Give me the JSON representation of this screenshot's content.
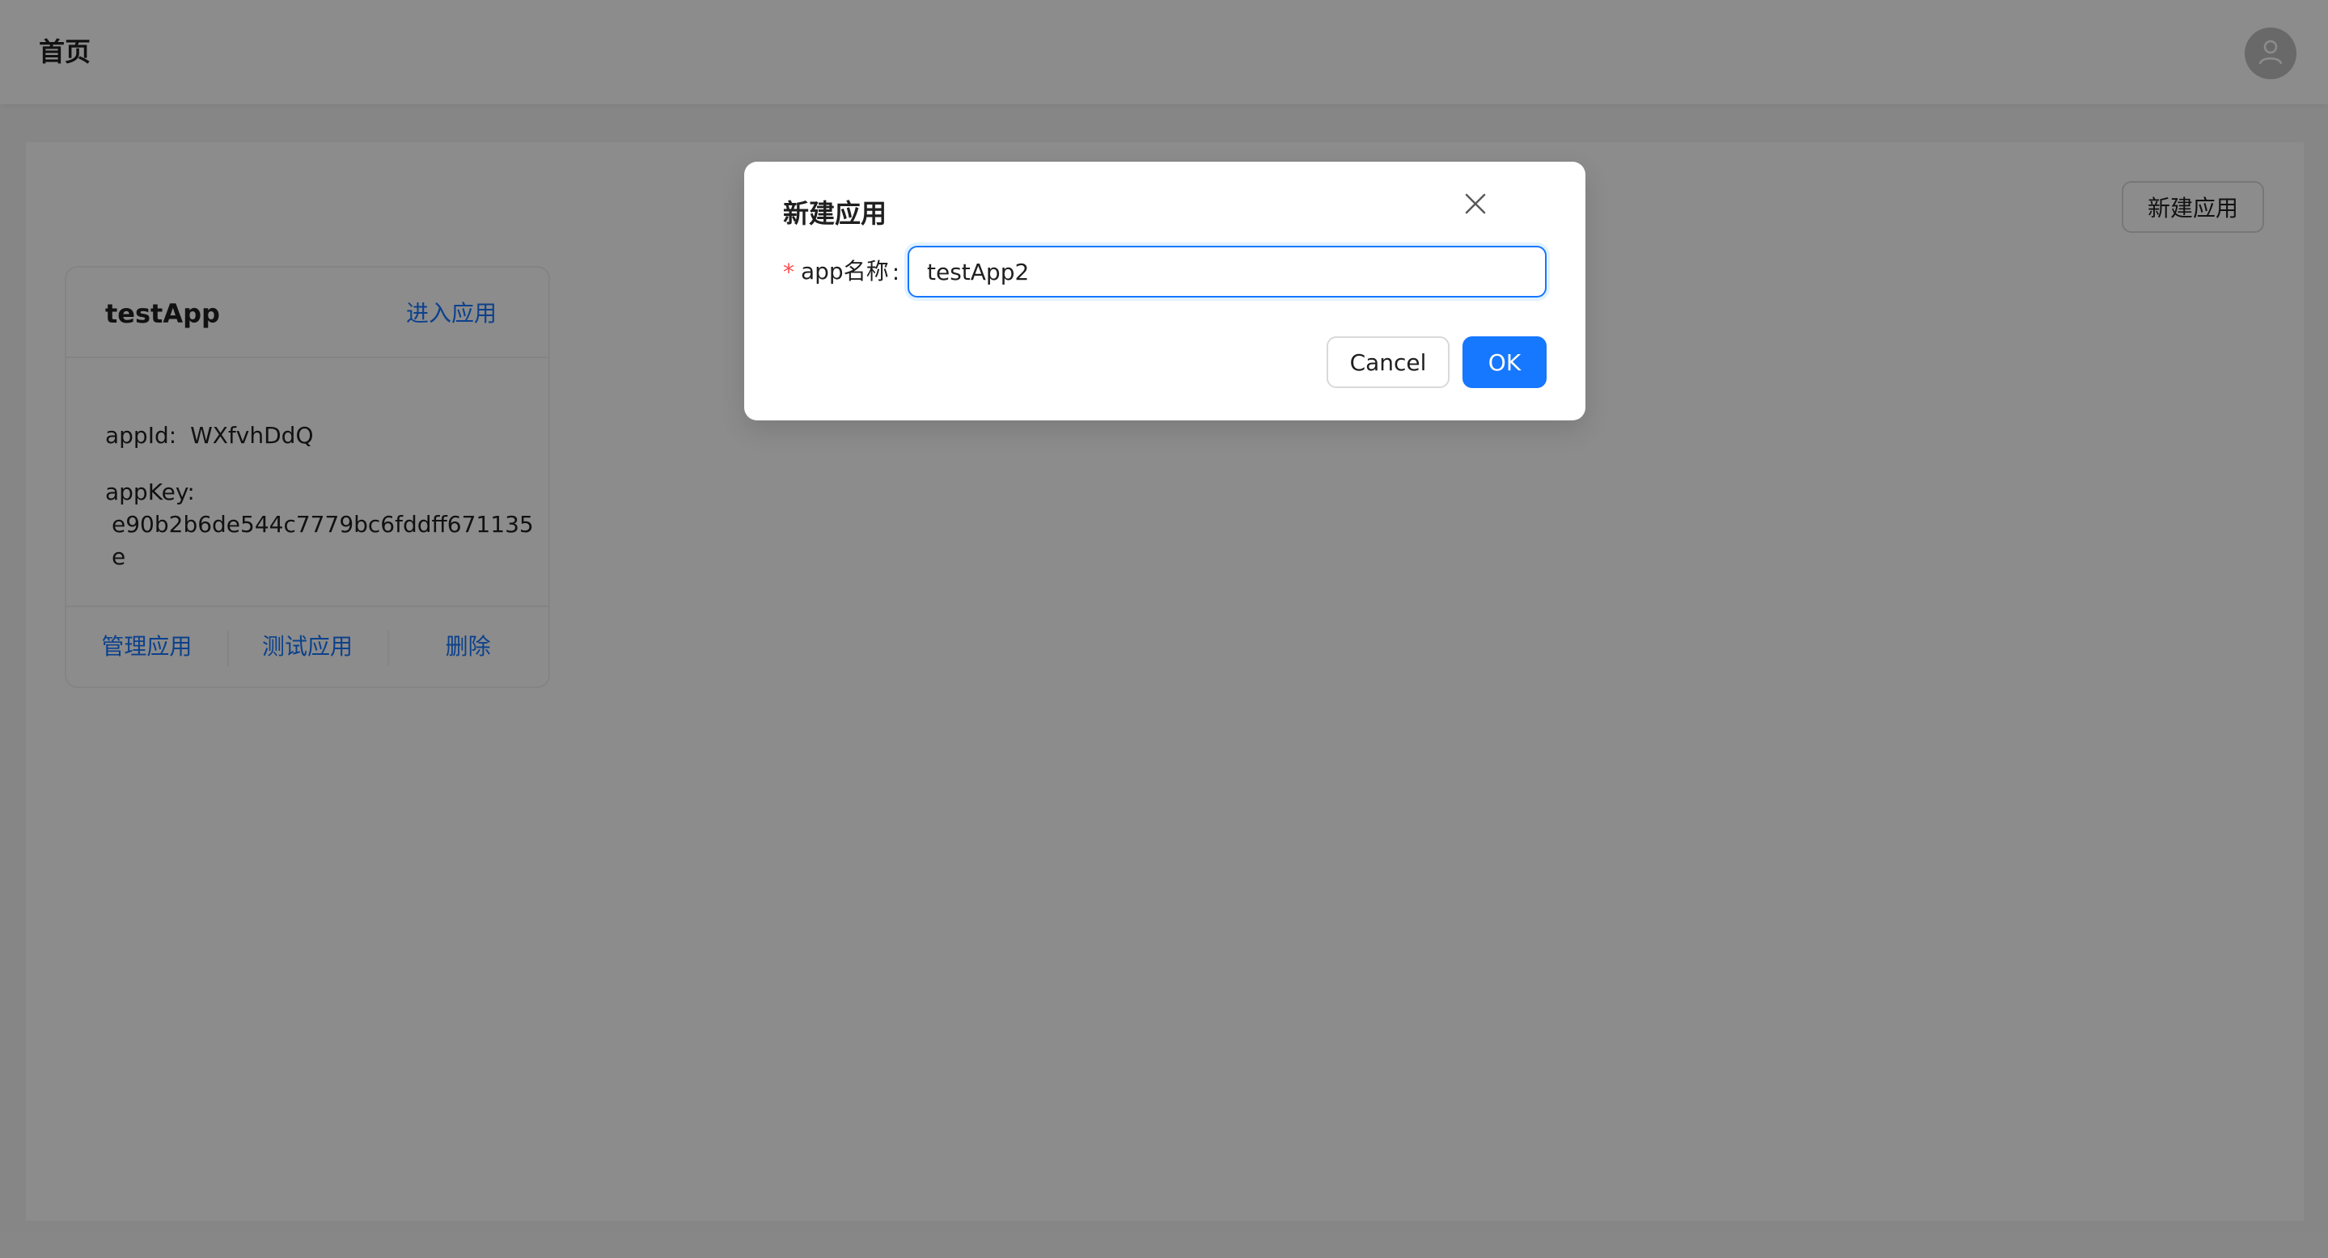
{
  "header": {
    "title": "首页",
    "avatar_icon": "user-icon"
  },
  "toolbar": {
    "new_app_label": "新建应用"
  },
  "app_card": {
    "title": "testApp",
    "enter_label": "进入应用",
    "app_id_label": "appId:",
    "app_id_value": "WXfvhDdQ",
    "app_key_label": "appKey:",
    "app_key_value": "e90b2b6de544c7779bc6fddff671135e",
    "actions": [
      "管理应用",
      "测试应用",
      "删除"
    ]
  },
  "modal": {
    "title": "新建应用",
    "close_icon": "close-icon",
    "field_label": "app名称",
    "field_colon": ":",
    "required_mark": "*",
    "input_value": "testApp2",
    "cancel_label": "Cancel",
    "ok_label": "OK"
  },
  "colors": {
    "primary": "#1677ff",
    "required": "#ff4d4f",
    "mask": "rgba(0,0,0,0.45)"
  }
}
